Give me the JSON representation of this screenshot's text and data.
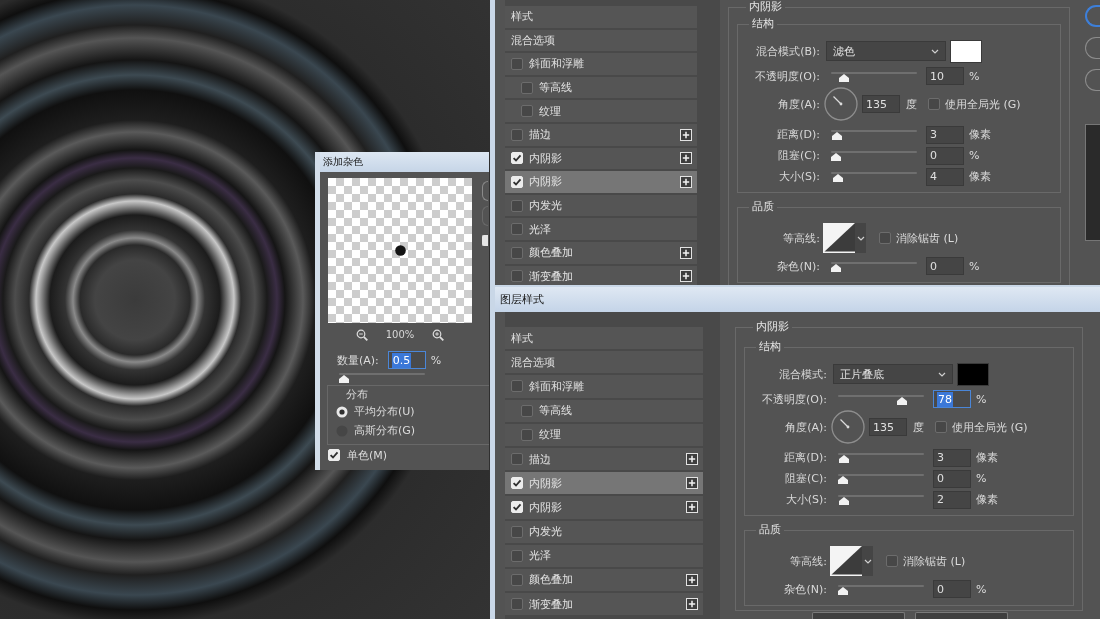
{
  "noise_dialog": {
    "title": "添加杂色",
    "zoom": "100%",
    "amount": {
      "label": "数量(A):",
      "value": "0.5",
      "unit": "%",
      "text_selected": true,
      "level": 0
    },
    "distribution": {
      "title": "分布",
      "options": [
        {
          "label": "平均分布(U)",
          "selected": true
        },
        {
          "label": "高斯分布(G)",
          "selected": false
        }
      ]
    },
    "monochrome": {
      "label": "单色(M)",
      "checked": true
    },
    "side_buttons": [
      {
        "default": false
      },
      {
        "default": false
      }
    ],
    "preview_checkbox": {
      "checked": true
    }
  },
  "layer_style_dialogs": [
    {
      "styles": [
        {
          "label": "样式",
          "kind": "header",
          "selected": false
        },
        {
          "label": "混合选项",
          "kind": "header",
          "selected": false
        },
        {
          "label": "斜面和浮雕",
          "kind": "effect",
          "checked": false,
          "selected": false,
          "add_button": false
        },
        {
          "label": "等高线",
          "kind": "sub_effect",
          "checked": false,
          "selected": false,
          "add_button": false
        },
        {
          "label": "纹理",
          "kind": "sub_effect",
          "checked": false,
          "selected": false,
          "add_button": false
        },
        {
          "label": "描边",
          "kind": "effect",
          "checked": false,
          "selected": false,
          "add_button": true
        },
        {
          "label": "内阴影",
          "kind": "effect",
          "checked": true,
          "selected": false,
          "add_button": true
        },
        {
          "label": "内阴影",
          "kind": "effect",
          "checked": true,
          "selected": true,
          "add_button": true
        },
        {
          "label": "内发光",
          "kind": "effect",
          "checked": false,
          "selected": false,
          "add_button": false
        },
        {
          "label": "光泽",
          "kind": "effect",
          "checked": false,
          "selected": false,
          "add_button": false
        },
        {
          "label": "颜色叠加",
          "kind": "effect",
          "checked": false,
          "selected": false,
          "add_button": true
        },
        {
          "label": "渐变叠加",
          "kind": "effect",
          "checked": false,
          "selected": false,
          "add_button": true
        }
      ],
      "panel": {
        "title": "内阴影",
        "structure": {
          "title": "结构",
          "controls": [
            {
              "kind": "blend",
              "label": "混合模式(B):",
              "value": "滤色",
              "color": "#ffffff"
            },
            {
              "kind": "slider",
              "label": "不透明度(O):",
              "value": "10",
              "unit": "%",
              "level": 0.1
            },
            {
              "kind": "angle",
              "label": "角度(A):",
              "value": "135",
              "unit": "度",
              "option": {
                "label": "使用全局光 (G)",
                "checked": false
              }
            },
            {
              "kind": "slider",
              "label": "距离(D):",
              "value": "3",
              "unit": "像素",
              "level": 0.01
            },
            {
              "kind": "slider",
              "label": "阻塞(C):",
              "value": "0",
              "unit": "%",
              "level": 0
            },
            {
              "kind": "slider",
              "label": "大小(S):",
              "value": "4",
              "unit": "像素",
              "level": 0.02
            }
          ]
        },
        "quality": {
          "title": "品质",
          "controls": [
            {
              "kind": "contour",
              "label": "等高线:",
              "option": {
                "label": "消除锯齿 (L)",
                "checked": false
              }
            },
            {
              "kind": "slider",
              "label": "杂色(N):",
              "value": "0",
              "unit": "%",
              "level": 0
            }
          ]
        }
      },
      "side_buttons": [
        {
          "default": true
        },
        {
          "default": false
        },
        {
          "default": false
        }
      ]
    },
    {
      "title": "图层样式",
      "styles": [
        {
          "label": "样式",
          "kind": "header",
          "selected": false
        },
        {
          "label": "混合选项",
          "kind": "header",
          "selected": false
        },
        {
          "label": "斜面和浮雕",
          "kind": "effect",
          "checked": false,
          "selected": false,
          "add_button": false
        },
        {
          "label": "等高线",
          "kind": "sub_effect",
          "checked": false,
          "selected": false,
          "add_button": false
        },
        {
          "label": "纹理",
          "kind": "sub_effect",
          "checked": false,
          "selected": false,
          "add_button": false
        },
        {
          "label": "描边",
          "kind": "effect",
          "checked": false,
          "selected": false,
          "add_button": true
        },
        {
          "label": "内阴影",
          "kind": "effect",
          "checked": true,
          "selected": true,
          "add_button": true
        },
        {
          "label": "内阴影",
          "kind": "effect",
          "checked": true,
          "selected": false,
          "add_button": true
        },
        {
          "label": "内发光",
          "kind": "effect",
          "checked": false,
          "selected": false,
          "add_button": false
        },
        {
          "label": "光泽",
          "kind": "effect",
          "checked": false,
          "selected": false,
          "add_button": false
        },
        {
          "label": "颜色叠加",
          "kind": "effect",
          "checked": false,
          "selected": false,
          "add_button": true
        },
        {
          "label": "渐变叠加",
          "kind": "effect",
          "checked": false,
          "selected": false,
          "add_button": true
        }
      ],
      "panel": {
        "title": "内阴影",
        "structure": {
          "title": "结构",
          "controls": [
            {
              "kind": "blend",
              "label": "混合模式:",
              "value": "正片叠底",
              "color": "#000000"
            },
            {
              "kind": "slider",
              "label": "不透明度(O):",
              "value": "78",
              "unit": "%",
              "level": 0.78,
              "text_selected": true
            },
            {
              "kind": "angle",
              "label": "角度(A):",
              "value": "135",
              "unit": "度",
              "option": {
                "label": "使用全局光 (G)",
                "checked": false
              }
            },
            {
              "kind": "slider",
              "label": "距离(D):",
              "value": "3",
              "unit": "像素",
              "level": 0.01
            },
            {
              "kind": "slider",
              "label": "阻塞(C):",
              "value": "0",
              "unit": "%",
              "level": 0
            },
            {
              "kind": "slider",
              "label": "大小(S):",
              "value": "2",
              "unit": "像素",
              "level": 0.01
            }
          ]
        },
        "quality": {
          "title": "品质",
          "controls": [
            {
              "kind": "contour",
              "label": "等高线:",
              "option": {
                "label": "消除锯齿 (L)",
                "checked": false
              }
            },
            {
              "kind": "slider",
              "label": "杂色(N):",
              "value": "0",
              "unit": "%",
              "level": 0
            }
          ]
        }
      },
      "footer_buttons": [
        {
          "default": false
        },
        {
          "default": false
        }
      ]
    }
  ]
}
